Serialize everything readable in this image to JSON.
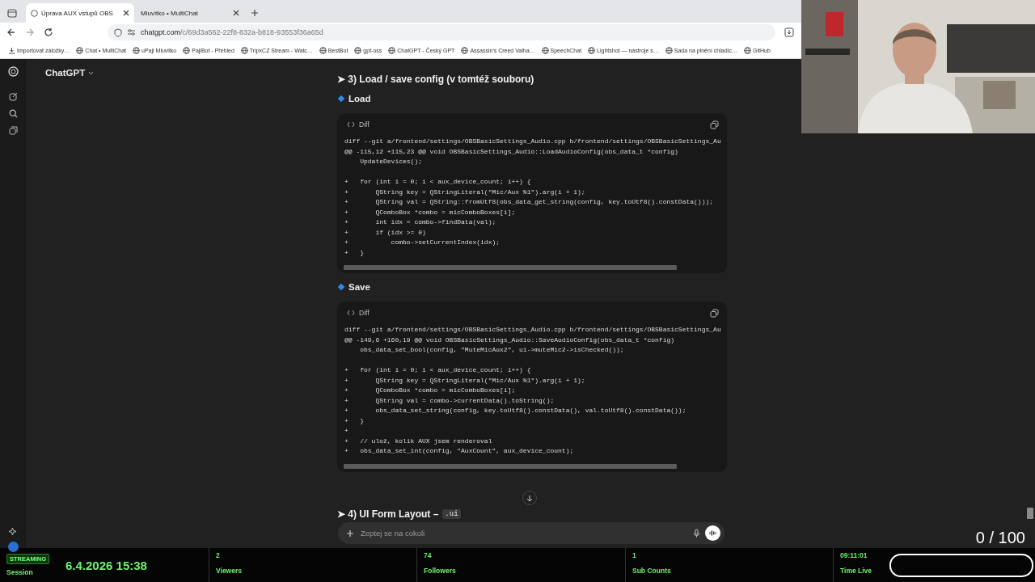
{
  "browser": {
    "tabs": [
      {
        "title": "Úprava AUX vstupů OBS",
        "selected": true
      },
      {
        "title": "Mluvítko • MultiChat",
        "selected": false
      }
    ],
    "url": {
      "host": "chatgpt.com",
      "path": "/c/69d3a562-22f8-832a-b818-93553f36a65d"
    },
    "bookmarks": [
      "Importovat záložky…",
      "Chat • MultiChat",
      "uPaji Mluvitko",
      "PajiBot - Přehled",
      "TripxCZ Stream - Watc…",
      "BestBot",
      "gpt-oss",
      "ChatGPT - Český GPT",
      "Assassin's Creed Valha…",
      "SpeechChat",
      "Lightshot — nástroje s…",
      "Sada na plnění chladíc…",
      "GitHub"
    ]
  },
  "chat": {
    "title": "ChatGPT",
    "sections": [
      {
        "kind": "heading",
        "text": "➤ 3) Load / save config (v tomtéž souboru)"
      },
      {
        "kind": "subheading",
        "text": "Load"
      },
      {
        "kind": "code",
        "language": "Diff",
        "code": "diff --git a/frontend/settings/OBSBasicSettings_Audio.cpp b/frontend/settings/OBSBasicSettings_Au\n@@ -115,12 +115,23 @@ void OBSBasicSettings_Audio::LoadAudioConfig(obs_data_t *config)\n    UpdateDevices();\n\n+   for (int i = 0; i < aux_device_count; i++) {\n+       QString key = QStringLiteral(\"Mic/Aux %1\").arg(i + 1);\n+       QString val = QString::fromUtf8(obs_data_get_string(config, key.toUtf8().constData()));\n+       QComboBox *combo = micComboBoxes[i];\n+       int idx = combo->findData(val);\n+       if (idx >= 0)\n+           combo->setCurrentIndex(idx);\n+   }"
      },
      {
        "kind": "subheading",
        "text": "Save"
      },
      {
        "kind": "code",
        "language": "Diff",
        "code": "diff --git a/frontend/settings/OBSBasicSettings_Audio.cpp b/frontend/settings/OBSBasicSettings_Au\n@@ -149,6 +160,19 @@ void OBSBasicSettings_Audio::SaveAudioConfig(obs_data_t *config)\n    obs_data_set_bool(config, \"MuteMicAux2\", ui->muteMic2->isChecked());\n\n+   for (int i = 0; i < aux_device_count; i++) {\n+       QString key = QStringLiteral(\"Mic/Aux %1\").arg(i + 1);\n+       QComboBox *combo = micComboBoxes[i];\n+       QString val = combo->currentData().toString();\n+       obs_data_set_string(config, key.toUtf8().constData(), val.toUtf8().constData());\n+   }\n+\n+   // ulož, kolik AUX jsem renderoval\n+   obs_data_set_int(config, \"AuxCount\", aux_device_count);"
      },
      {
        "kind": "heading",
        "text": "➤ 4) UI Form Layout –",
        "code": ".ui"
      }
    ],
    "composer": {
      "placeholder": "Zeptej se na cokoli"
    }
  },
  "stream": {
    "badge": "STREAMING",
    "session": "Session",
    "datetime": "6.4.2026 15:38",
    "stats": [
      {
        "value": "2",
        "label": "Viewers"
      },
      {
        "value": "74",
        "label": "Followers"
      },
      {
        "value": "1",
        "label": "Sub Counts"
      },
      {
        "value": "09:11:01",
        "label": "Time Live"
      }
    ],
    "counter": "0 / 100"
  }
}
